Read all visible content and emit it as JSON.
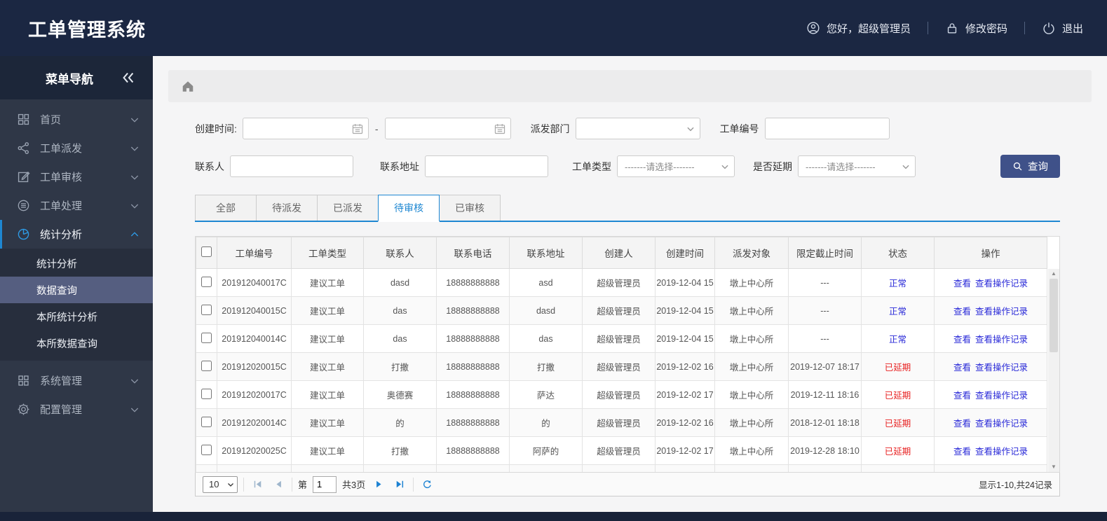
{
  "header": {
    "title": "工单管理系统",
    "greeting": "您好，超级管理员",
    "change_password": "修改密码",
    "logout": "退出"
  },
  "sidebar": {
    "title": "菜单导航",
    "items": [
      {
        "label": "首页",
        "icon": "grid-icon"
      },
      {
        "label": "工单派发",
        "icon": "share-icon"
      },
      {
        "label": "工单审核",
        "icon": "edit-icon"
      },
      {
        "label": "工单处理",
        "icon": "process-icon"
      },
      {
        "label": "统计分析",
        "icon": "pie-icon",
        "expanded": true,
        "children": [
          {
            "label": "统计分析"
          },
          {
            "label": "数据查询",
            "active": true
          },
          {
            "label": "本所统计分析"
          },
          {
            "label": "本所数据查询"
          }
        ]
      },
      {
        "label": "系统管理",
        "icon": "modules-icon"
      },
      {
        "label": "配置管理",
        "icon": "gear-icon"
      }
    ]
  },
  "filters": {
    "create_time_label": "创建时间:",
    "range_separator": "-",
    "dispatch_dept_label": "派发部门",
    "order_no_label": "工单编号",
    "contact_label": "联系人",
    "address_label": "联系地址",
    "order_type_label": "工单类型",
    "delay_label": "是否延期",
    "select_placeholder": "-------请选择-------",
    "search_button": "查询"
  },
  "tabs": [
    {
      "label": "全部"
    },
    {
      "label": "待派发"
    },
    {
      "label": "已派发"
    },
    {
      "label": "待审核",
      "active": true
    },
    {
      "label": "已审核"
    }
  ],
  "table": {
    "columns": [
      "工单编号",
      "工单类型",
      "联系人",
      "联系电话",
      "联系地址",
      "创建人",
      "创建时间",
      "派发对象",
      "限定截止时间",
      "状态",
      "操作"
    ],
    "action_view": "查看",
    "action_log": "查看操作记录",
    "rows": [
      {
        "id": "201912040017C",
        "type": "建议工单",
        "contact": "dasd",
        "phone": "18888888888",
        "address": "asd",
        "creator": "超级管理员",
        "created": "2019-12-04 15",
        "target": "墩上中心所",
        "deadline": "---",
        "status": "正常",
        "status_type": "normal"
      },
      {
        "id": "201912040015C",
        "type": "建议工单",
        "contact": "das",
        "phone": "18888888888",
        "address": "dasd",
        "creator": "超级管理员",
        "created": "2019-12-04 15",
        "target": "墩上中心所",
        "deadline": "---",
        "status": "正常",
        "status_type": "normal"
      },
      {
        "id": "201912040014C",
        "type": "建议工单",
        "contact": "das",
        "phone": "18888888888",
        "address": "das",
        "creator": "超级管理员",
        "created": "2019-12-04 15",
        "target": "墩上中心所",
        "deadline": "---",
        "status": "正常",
        "status_type": "normal"
      },
      {
        "id": "201912020015C",
        "type": "建议工单",
        "contact": "打撒",
        "phone": "18888888888",
        "address": "打撒",
        "creator": "超级管理员",
        "created": "2019-12-02 16",
        "target": "墩上中心所",
        "deadline": "2019-12-07 18:17",
        "status": "已延期",
        "status_type": "delayed"
      },
      {
        "id": "201912020017C",
        "type": "建议工单",
        "contact": "奥德赛",
        "phone": "18888888888",
        "address": "萨达",
        "creator": "超级管理员",
        "created": "2019-12-02 17",
        "target": "墩上中心所",
        "deadline": "2019-12-11 18:16",
        "status": "已延期",
        "status_type": "delayed"
      },
      {
        "id": "201912020014C",
        "type": "建议工单",
        "contact": "的",
        "phone": "18888888888",
        "address": "的",
        "creator": "超级管理员",
        "created": "2019-12-02 16",
        "target": "墩上中心所",
        "deadline": "2018-12-01 18:18",
        "status": "已延期",
        "status_type": "delayed"
      },
      {
        "id": "201912020025C",
        "type": "建议工单",
        "contact": "打撒",
        "phone": "18888888888",
        "address": "阿萨的",
        "creator": "超级管理员",
        "created": "2019-12-02 17",
        "target": "墩上中心所",
        "deadline": "2019-12-28 18:10",
        "status": "已延期",
        "status_type": "delayed"
      },
      {
        "empty": true,
        "id": "",
        "type": "",
        "contact": "",
        "phone": "",
        "address": "",
        "creator": "",
        "created": "",
        "target": "",
        "deadline": "",
        "status": "",
        "status_type": ""
      }
    ]
  },
  "pagination": {
    "page_size": "10",
    "page_prefix": "第",
    "current_page": "1",
    "total_pages": "共3页",
    "summary": "显示1-10,共24记录"
  },
  "colors": {
    "accent": "#1e87d2",
    "header-bg": "#1b2742",
    "sidebar-bg": "#2f3747",
    "sidebar-strip-bg": "#1c2639",
    "submenu-bg": "#272e3d",
    "active-item-bg": "#555e80",
    "button-bg": "#3f5189",
    "link-blue": "#2a2ad8",
    "status-normal": "#2a2ad8",
    "status-delayed": "#e82222"
  }
}
